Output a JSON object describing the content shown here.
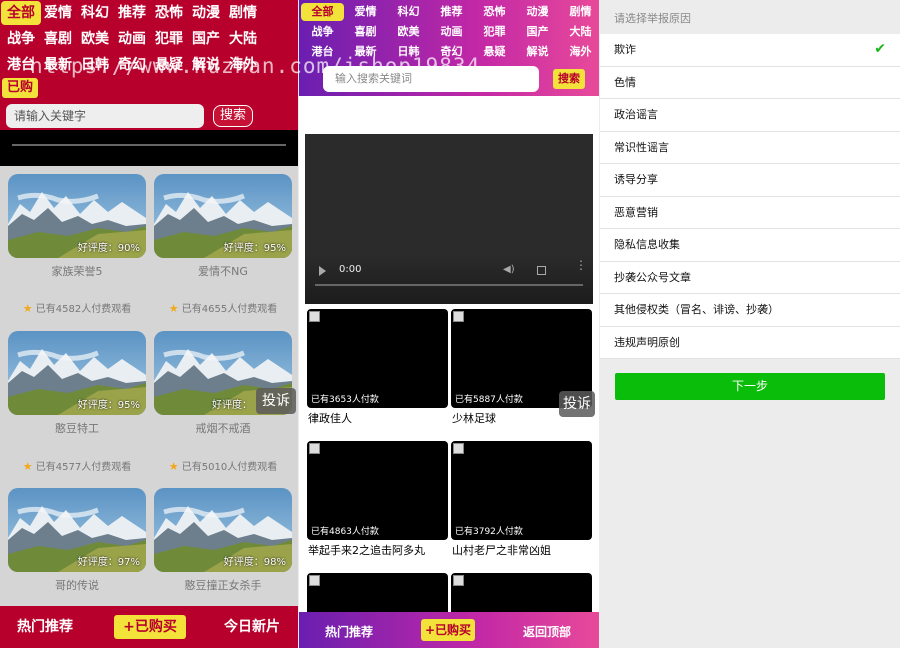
{
  "panel1": {
    "categories": [
      "全部",
      "爱情",
      "科幻",
      "推荐",
      "恐怖",
      "动漫",
      "剧情",
      "战争",
      "喜剧",
      "欧美",
      "动画",
      "犯罪",
      "国产",
      "大陆",
      "港台",
      "最新",
      "日韩",
      "奇幻",
      "悬疑",
      "解说",
      "海外"
    ],
    "bought_tag": "已购",
    "search_placeholder": "请输入关键字",
    "search_button": "搜索",
    "movies": [
      {
        "title": "家族荣誉5",
        "rating": "好评度：90%",
        "viewers": "已有4582人付费观看"
      },
      {
        "title": "爱情不NG",
        "rating": "好评度：95%",
        "viewers": "已有4655人付费观看"
      },
      {
        "title": "憨豆特工",
        "rating": "好评度：95%",
        "viewers": "已有4577人付费观看"
      },
      {
        "title": "戒烟不戒酒",
        "rating": "好评度：",
        "viewers": "已有5010人付费观看"
      },
      {
        "title": "哥的传说",
        "rating": "好评度：97%",
        "viewers": ""
      },
      {
        "title": "憨豆撞正女杀手",
        "rating": "好评度：98%",
        "viewers": ""
      }
    ],
    "report_button": "投诉",
    "bottom": {
      "left": "热门推荐",
      "mid": "+已购买",
      "right": "今日新片"
    }
  },
  "panel2": {
    "categories": [
      "全部",
      "爱情",
      "科幻",
      "推荐",
      "恐怖",
      "动漫",
      "剧情",
      "战争",
      "喜剧",
      "欧美",
      "动画",
      "犯罪",
      "国产",
      "大陆",
      "港台",
      "最新",
      "日韩",
      "奇幻",
      "悬疑",
      "解说",
      "海外"
    ],
    "search_placeholder": "输入搜索关键词",
    "search_button": "搜索",
    "video_time": "0:00",
    "videos": [
      {
        "title": "律政佳人",
        "paid": "已有3653人付款"
      },
      {
        "title": "少林足球",
        "paid": "已有5887人付款"
      },
      {
        "title": "举起手来2之追击阿多丸",
        "paid": "已有4863人付款"
      },
      {
        "title": "山村老尸之非常凶姐",
        "paid": "已有3792人付款"
      }
    ],
    "report_button": "投诉",
    "bottom": {
      "left": "热门推荐",
      "mid": "+已购买",
      "right": "返回顶部"
    }
  },
  "panel3": {
    "header": "请选择举报原因",
    "reasons": [
      "欺诈",
      "色情",
      "政治谣言",
      "常识性谣言",
      "诱导分享",
      "恶意营销",
      "隐私信息收集",
      "抄袭公众号文章",
      "其他侵权类（冒名、诽谤、抄袭）",
      "违规声明原创"
    ],
    "selected_mark": "✔",
    "next_button": "下一步"
  },
  "watermark": "https://www.huzhan.com/ishop19834",
  "colors": {
    "red_theme": "#b8002c",
    "yellow_accent": "#f2e23a",
    "purple_start": "#6a1eb0",
    "pink_end": "#e84a9a",
    "green_button": "#0bbd0b"
  }
}
